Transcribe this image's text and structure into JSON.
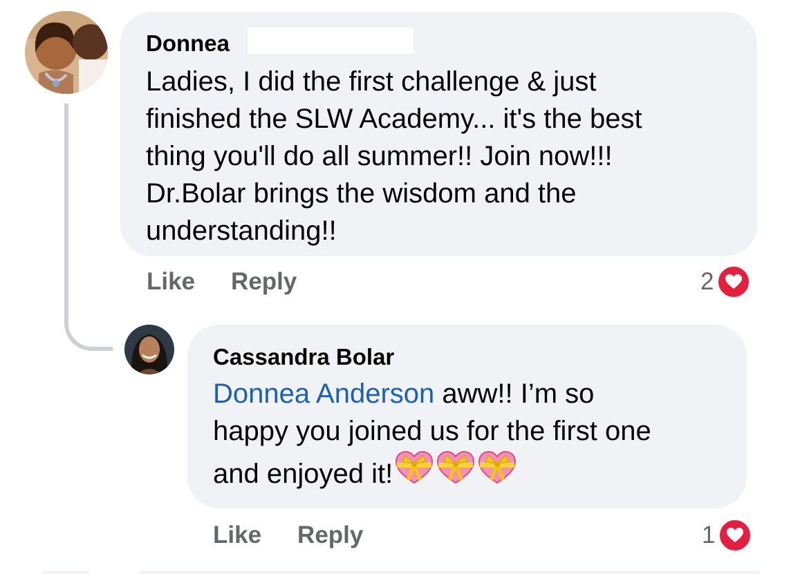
{
  "comment": {
    "author": "Donnea",
    "text_lines": [
      "Ladies, I did the first challenge  & just",
      "finished the  SLW Academy... it's the best",
      "thing you'll do all summer!! Join now!!!",
      "Dr.Bolar brings the wisdom and the",
      "understanding!!"
    ],
    "like_label": "Like",
    "reply_label": "Reply",
    "reaction_count": "2",
    "reaction_icon": "heart-icon"
  },
  "reply": {
    "author": "Cassandra Bolar",
    "mention": "Donnea Anderson",
    "text_line1_rest": " aww!! I’m so",
    "text_line2": "happy you joined us for the first one",
    "text_line3": "and enjoyed it!",
    "emojis": [
      "heart-with-ribbon-emoji",
      "heart-with-ribbon-emoji",
      "heart-with-ribbon-emoji"
    ],
    "like_label": "Like",
    "reply_label": "Reply",
    "reaction_count": "1",
    "reaction_icon": "heart-icon"
  },
  "colors": {
    "bubble_bg": "#f0f2f5",
    "text": "#050505",
    "secondary_text": "#65676b",
    "mention": "#1b5fbd",
    "heart": "#e41e3f",
    "thread_line": "#ced0d4"
  }
}
